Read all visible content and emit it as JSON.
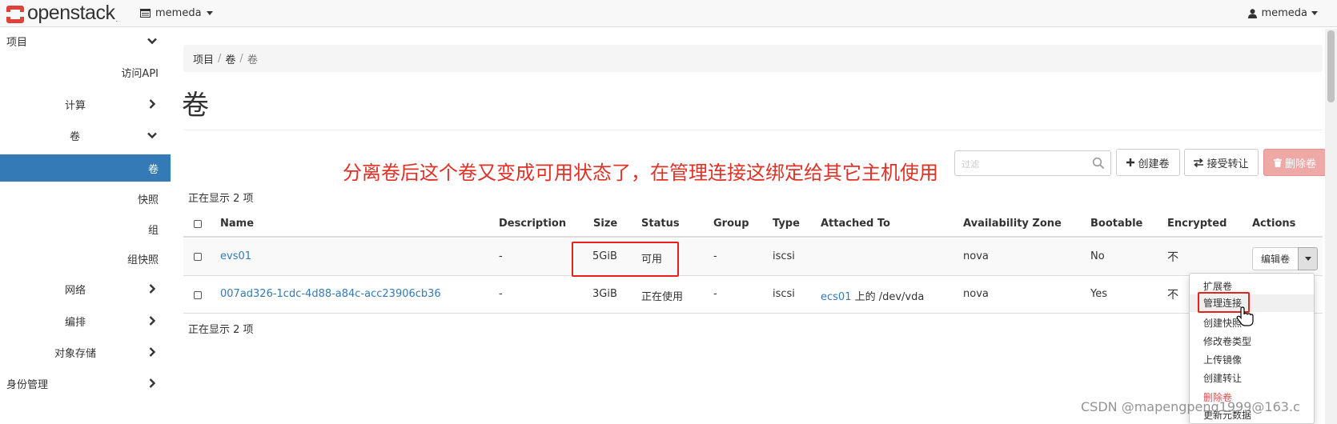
{
  "brand": {
    "name": "openstack",
    "tm": "."
  },
  "topbar": {
    "project": "memeda",
    "user": "memeda"
  },
  "sidebar": {
    "items": [
      {
        "label": "项目",
        "chevron": "down"
      },
      {
        "label": "访问API",
        "chevron": ""
      },
      {
        "label": "计算",
        "chevron": "right"
      },
      {
        "label": "卷",
        "chevron": "down"
      },
      {
        "label": "卷",
        "chevron": "",
        "active": true
      },
      {
        "label": "快照",
        "chevron": ""
      },
      {
        "label": "组",
        "chevron": ""
      },
      {
        "label": "组快照",
        "chevron": ""
      },
      {
        "label": "网络",
        "chevron": "right"
      },
      {
        "label": "编排",
        "chevron": "right"
      },
      {
        "label": "对象存储",
        "chevron": "right"
      },
      {
        "label": "身份管理",
        "chevron": "right"
      }
    ]
  },
  "breadcrumb": [
    "项目",
    "卷",
    "卷"
  ],
  "page_title": "卷",
  "annotation": "分离卷后这个卷又变成可用状态了，在管理连接这绑定给其它主机使用",
  "toolbar": {
    "search_placeholder": "过滤",
    "create": "创建卷",
    "accept_transfer": "接受转让",
    "delete": "删除卷"
  },
  "count_text": "正在显示 2 项",
  "table": {
    "headers": [
      "Name",
      "Description",
      "Size",
      "Status",
      "Group",
      "Type",
      "Attached To",
      "Availability Zone",
      "Bootable",
      "Encrypted",
      "Actions"
    ],
    "rows": [
      {
        "name": "evs01",
        "description": "-",
        "size": "5GiB",
        "status": "可用",
        "group": "-",
        "type": "iscsi",
        "attached_link": "",
        "attached_rest": "",
        "zone": "nova",
        "bootable": "No",
        "encrypted": "不",
        "action": "编辑卷"
      },
      {
        "name": "007ad326-1cdc-4d88-a84c-acc23906cb36",
        "description": "-",
        "size": "3GiB",
        "status": "正在使用",
        "group": "-",
        "type": "iscsi",
        "attached_link": "ecs01",
        "attached_rest": " 上的 /dev/vda",
        "zone": "nova",
        "bootable": "Yes",
        "encrypted": "不",
        "action": ""
      }
    ]
  },
  "dropdown": [
    "扩展卷",
    "管理连接",
    "创建快照",
    "修改卷类型",
    "上传镜像",
    "创建转让",
    "删除卷",
    "更新元数据"
  ],
  "watermark": "CSDN @mapengpeng1999@163.c",
  "colors": {
    "accent": "#337ab7",
    "annotation": "#e03127",
    "highlight": "#e8201e",
    "danger": "#d9534f"
  }
}
